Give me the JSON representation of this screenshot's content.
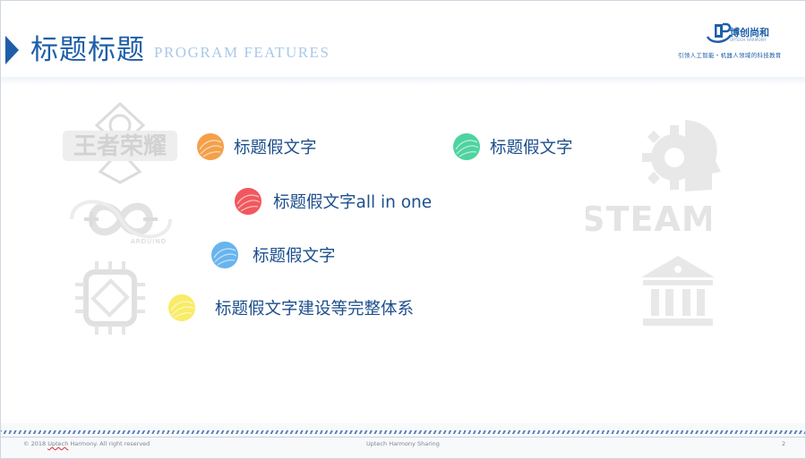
{
  "header": {
    "title": "标题标题",
    "subtitle": "PROGRAM  FEATURES"
  },
  "brand": {
    "name": "博创尚和",
    "name_en": "UPTECH HARMONY",
    "tagline": "引领人工智能・机器人领域的科技教育",
    "color": "#1d5ea8"
  },
  "background_logos": [
    {
      "name": "honor-of-kings-logo",
      "text": "王者荣耀"
    },
    {
      "name": "arduino-logo",
      "text": "ARDUINO"
    },
    {
      "name": "chip-logo",
      "text": ""
    },
    {
      "name": "gear-head-logo",
      "text": ""
    },
    {
      "name": "steam-logo",
      "text": "STEAM"
    },
    {
      "name": "building-logo",
      "text": ""
    }
  ],
  "features": [
    {
      "text": "标题假文字",
      "color": "#f4a04a"
    },
    {
      "text": "标题假文字",
      "color": "#4fd3a0"
    },
    {
      "text": "标题假文字all in one",
      "color": "#f0585e"
    },
    {
      "text": "标题假文字",
      "color": "#68b4ee"
    },
    {
      "text": "标题假文字建设等完整体系",
      "color": "#f8ec68"
    }
  ],
  "footer": {
    "copyright_prefix": "© 2018 ",
    "copyright_brand": "Uptech",
    "copyright_suffix": " Harmony. All right reserved",
    "center": "Uptech Harmony Sharing",
    "page_number": "2"
  }
}
